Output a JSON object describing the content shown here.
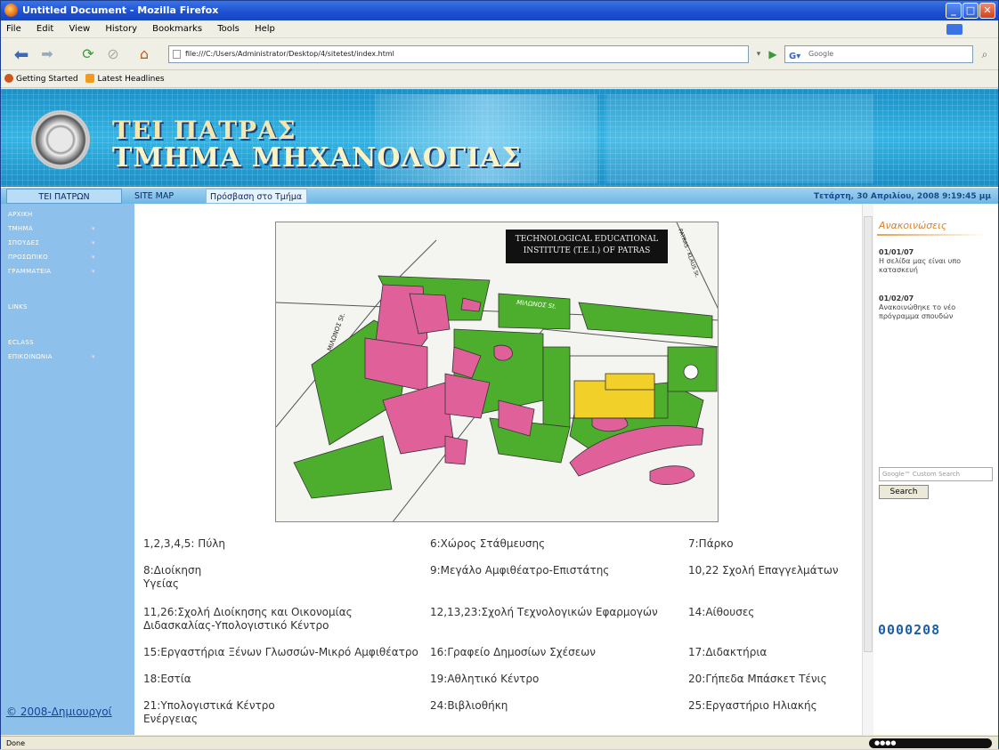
{
  "window": {
    "title": "Untitled Document - Mozilla Firefox"
  },
  "menu": [
    "File",
    "Edit",
    "View",
    "History",
    "Bookmarks",
    "Tools",
    "Help"
  ],
  "address": {
    "url": "file:///C:/Users/Administrator/Desktop/4/sitetest/index.html"
  },
  "search": {
    "placeholder": "Google"
  },
  "bookmarks": [
    "Getting Started",
    "Latest Headlines"
  ],
  "banner": {
    "line1": "ΤΕΙ ΠΑΤΡΑΣ",
    "line2": "ΤΜΗΜΑ ΜΗΧΑΝΟΛΟΓΙΑΣ"
  },
  "site_nav": {
    "items": [
      "ΤΕΙ ΠΑΤΡΩΝ",
      "SITE MAP",
      "Πρόσβαση στο Τμήμα"
    ],
    "date": "Τετάρτη, 30 Απριλίου, 2008 9:19:45 μμ"
  },
  "left_nav": {
    "items": [
      "ΑΡΧΙΚΗ",
      "ΤΜΗΜΑ",
      "ΣΠΟΥΔΕΣ",
      "ΠΡΟΣΩΠΙΚΟ",
      "ΓΡΑΜΜΑΤΕΙΑ",
      "LINKS",
      "ECLASS",
      "ΕΠΙΚΟΙΝΩΝΙΑ"
    ],
    "copyright": "© 2008-Δημιουργοί"
  },
  "map": {
    "caption1": "TECHNOLOGICAL EDUCATIONAL",
    "caption2": "INSTITUTE (T.E.I.) OF PATRAS",
    "street1": "ΜΙΛΩΝΟΣ St.",
    "street2": "ΜΙΛΩΝΟΣ St.",
    "street3": "PATRAS - KLAUS St."
  },
  "legend": [
    {
      "a": "1,2,3,4,5: Πύλη",
      "b": "6:Χώρος Στάθμευσης",
      "c": "7:Πάρκο"
    },
    {
      "a": "8:Διοίκηση",
      "a2": "Υγείας",
      "b": "9:Μεγάλο Αμφιθέατρο-Επιστάτης",
      "c": "10,22 Σχολή Επαγγελμάτων"
    },
    {
      "a": "11,26:Σχολή Διοίκησης και Οικονομίας",
      "a2": "Διδασκαλίας-Υπολογιστικό Κέντρο",
      "b": "12,13,23:Σχολή Τεχνολογικών Εφαρμογών",
      "c": "14:Αίθουσες"
    },
    {
      "a": "15:Εργαστήρια Ξένων Γλωσσών-Μικρό Αμφιθέατρο",
      "b": "16:Γραφείο Δημοσίων Σχέσεων",
      "c": "17:Διδακτήρια"
    },
    {
      "a": "18:Εστία",
      "b": "19:Αθλητικό Κέντρο",
      "c": "20:Γήπεδα Μπάσκετ Τένις"
    },
    {
      "a": "21:Υπολογιστικά Κέντρο",
      "a2": "Ενέργειας",
      "b": "24:Βιβλιοθήκη",
      "c": "25:Εργαστήριο Ηλιακής"
    }
  ],
  "announcements": {
    "heading": "Ανακοινώσεις",
    "items": [
      {
        "date": "01/01/07",
        "text": "Η σελίδα μας είναι υπο κατασκευή"
      },
      {
        "date": "01/02/07",
        "text": "Ανακοινώθηκε το νέο πρόγραμμα σπουδών"
      }
    ],
    "search_placeholder": "Google™ Custom Search",
    "search_button": "Search",
    "counter": "0000208"
  },
  "status": {
    "text": "Done"
  }
}
